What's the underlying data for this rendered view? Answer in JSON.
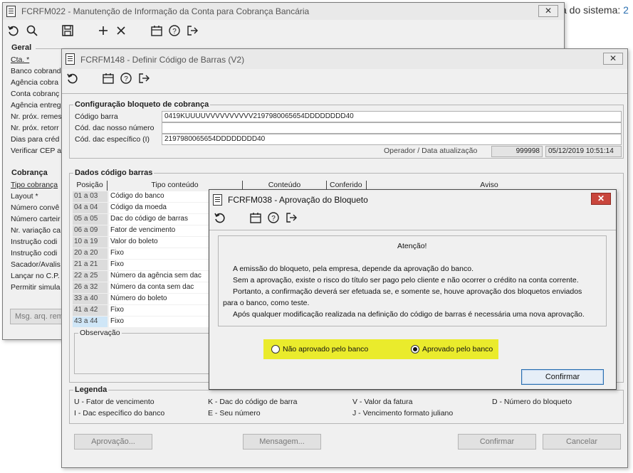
{
  "background": {
    "text": "a do sistema:",
    "number": "2"
  },
  "win1": {
    "title": "FCRFM022 - Manutenção de Informação da Conta para Cobrança Bancária",
    "close": "✕",
    "group_geral": "Geral",
    "geral_labels": [
      "Cta. *",
      "Banco cobrand",
      "Agência cobra",
      "Conta cobranç",
      "Agência entreg",
      "Nr. próx. remes",
      "Nr. próx. retorr",
      "Dias para créd",
      "Verificar CEP a"
    ],
    "group_cobranca": "Cobrança",
    "cobranca_labels": [
      "Tipo cobrança",
      "Layout *",
      "Número convê",
      "Número carteir",
      "Nr. variação ca",
      "Instrução codi",
      "Instrução codi",
      "Sacador/Avalis",
      "Lançar no C.P.",
      "Permitir simula"
    ],
    "msg_button": "Msg. arq. rem"
  },
  "win2": {
    "title": "FCRFM148 - Definir Código de Barras (V2)",
    "close": "✕",
    "config_group": "Configuração bloqueto de cobrança",
    "codigo_barra_label": "Código barra",
    "codigo_barra_value": "0419KUUUUVVVVVVVVVV2197980065654DDDDDDDD40",
    "cod_dac_nosso_label": "Cód. dac nosso número",
    "cod_dac_nosso_value": "",
    "cod_dac_especifico_label": "Cód. dac específico (I)",
    "cod_dac_especifico_value": "2197980065654DDDDDDDD40",
    "operador_label": "Operador / Data atualização",
    "operador_value": "999998",
    "data_value": "05/12/2019 10:51:14",
    "dados_group": "Dados código barras",
    "columns": [
      "Posição",
      "Tipo conteúdo",
      "Conteúdo",
      "Conferido",
      "Aviso"
    ],
    "rows": [
      {
        "pos": "01 a 03",
        "tipo": "Código do banco"
      },
      {
        "pos": "04 a 04",
        "tipo": "Código da moeda"
      },
      {
        "pos": "05 a 05",
        "tipo": "Dac do código de barras"
      },
      {
        "pos": "06 a 09",
        "tipo": "Fator de vencimento"
      },
      {
        "pos": "10 a 19",
        "tipo": "Valor do boleto"
      },
      {
        "pos": "20 a 20",
        "tipo": "Fixo"
      },
      {
        "pos": "21 a 21",
        "tipo": "Fixo"
      },
      {
        "pos": "22 a 25",
        "tipo": "Número da agência sem dac"
      },
      {
        "pos": "26 a 32",
        "tipo": "Número da conta sem dac"
      },
      {
        "pos": "33 a 40",
        "tipo": "Número do boleto"
      },
      {
        "pos": "41 a 42",
        "tipo": "Fixo"
      },
      {
        "pos": "43 a 44",
        "tipo": "Fixo"
      }
    ],
    "observacao_label": "Observação",
    "legenda_group": "Legenda",
    "legend": [
      "U - Fator de vencimento",
      "K - Dac do código de barra",
      "V - Valor da fatura",
      "D - Número do bloqueto",
      "I - Dac específico do banco",
      "E - Seu número",
      "J - Vencimento formato juliano"
    ],
    "btn_aprovacao": "Aprovação...",
    "btn_mensagem": "Mensagem...",
    "btn_confirmar": "Confirmar",
    "btn_cancelar": "Cancelar"
  },
  "dialog": {
    "title": "FCRFM038 - Aprovação do Bloqueto",
    "close": "✕",
    "heading": "Atenção!",
    "lines": [
      "A emissão do bloqueto, pela empresa, depende da aprovação do banco.",
      "Sem a aprovação, existe o risco do título ser pago pelo cliente e não ocorrer o crédito na conta corrente.",
      "Portanto, a confirmação deverá ser efetuada se, e somente se, houve aprovação dos bloquetos enviados",
      "para o banco, como teste.",
      "Após qualquer modificação realizada na definição do código de barras é necessária uma nova aprovação."
    ],
    "option_nao": "Não aprovado pelo banco",
    "option_sim": "Aprovado pelo banco",
    "selected": "Aprovado pelo banco",
    "highlight_color": "#eaeb2c",
    "confirm_button": "Confirmar"
  },
  "icons": {
    "refresh": "↺",
    "search": "🔍",
    "save": "💾",
    "add": "+",
    "remove": "✕",
    "calendar": "📅",
    "help": "?",
    "exit": "↦"
  }
}
